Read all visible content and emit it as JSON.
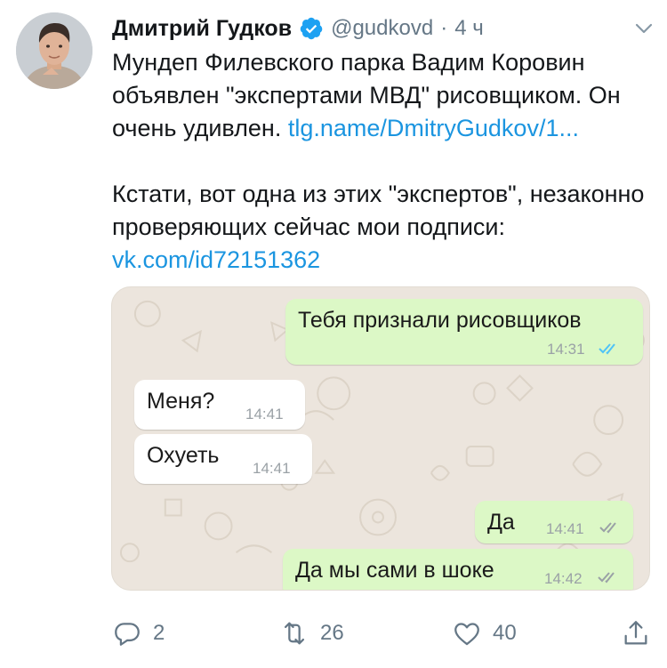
{
  "tweet": {
    "author_name": "Дмитрий Гудков",
    "handle": "@gudkovd",
    "separator": "·",
    "time_ago": "4 ч",
    "para1_text": "Мундеп Филевского парка Вадим Коровин объявлен \"экспертами МВД\" рисовщиком. Он очень удивлен.",
    "para1_link": "tlg.name/DmitryGudkov/1...",
    "para2_text": "Кстати, вот одна из этих \"экспертов\", незаконно проверяющих сейчас мои подписи:",
    "para2_link": "vk.com/id72151362"
  },
  "chat": {
    "messages": [
      {
        "text": "Тебя признали рисовщиков",
        "time": "14:31",
        "direction": "outgoing",
        "ticks": "double-blue"
      },
      {
        "text": "Меня?",
        "time": "14:41",
        "direction": "incoming"
      },
      {
        "text": "Охуеть",
        "time": "14:41",
        "direction": "incoming"
      },
      {
        "text": "Да",
        "time": "14:41",
        "direction": "outgoing",
        "ticks": "double-gray"
      },
      {
        "text": "Да мы сами в шоке",
        "time": "14:42",
        "direction": "outgoing",
        "ticks": "double-gray"
      }
    ]
  },
  "actions": {
    "reply_count": "2",
    "retweet_count": "26",
    "like_count": "40"
  },
  "colors": {
    "link": "#1b95e0",
    "verified_badge": "#1da1f2",
    "secondary_text": "#657786",
    "chat_background": "#ece5dd",
    "outgoing_bubble": "#dcf8c6",
    "incoming_bubble": "#ffffff",
    "read_ticks": "#4fc3f7"
  },
  "icons": [
    "verified-badge-icon",
    "chevron-down-icon",
    "reply-icon",
    "retweet-icon",
    "like-icon",
    "share-icon",
    "double-check-icon"
  ]
}
